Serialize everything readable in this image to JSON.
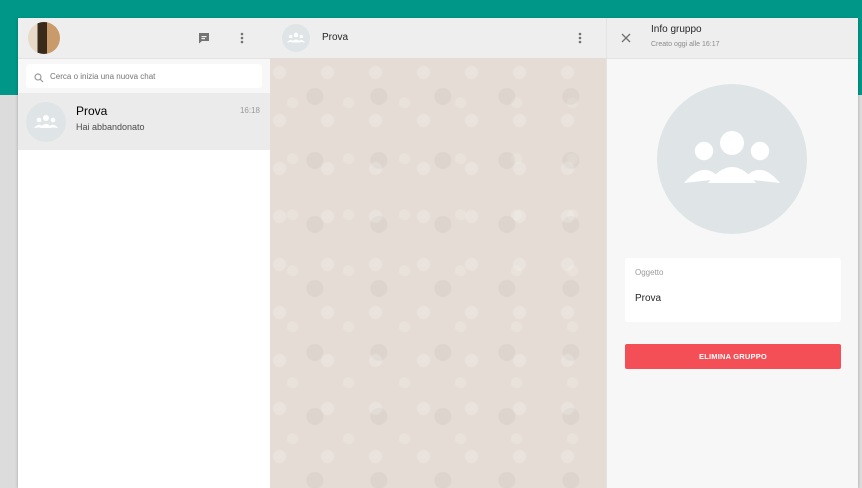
{
  "app": {
    "accent_color": "#009688",
    "danger_color": "#f44f56"
  },
  "left": {
    "header": {
      "avatar_icon": "user-photo-avatar",
      "new_chat_icon": "chat-bubble-icon",
      "menu_icon": "vertical-dots-icon"
    },
    "search": {
      "placeholder": "Cerca o inizia una nuova chat",
      "icon": "search-icon"
    },
    "chats": [
      {
        "name": "Prova",
        "time": "16:18",
        "preview": "Hai abbandonato",
        "avatar_icon": "group-icon"
      }
    ]
  },
  "middle": {
    "header": {
      "title": "Prova",
      "avatar_icon": "group-icon",
      "menu_icon": "vertical-dots-icon"
    }
  },
  "right": {
    "header": {
      "title": "Info gruppo",
      "subtitle": "Creato oggi alle 16:17",
      "close_icon": "close-icon"
    },
    "avatar_icon": "group-icon",
    "subject": {
      "label": "Oggetto",
      "value": "Prova"
    },
    "delete_button": "ELIMINA GRUPPO"
  }
}
